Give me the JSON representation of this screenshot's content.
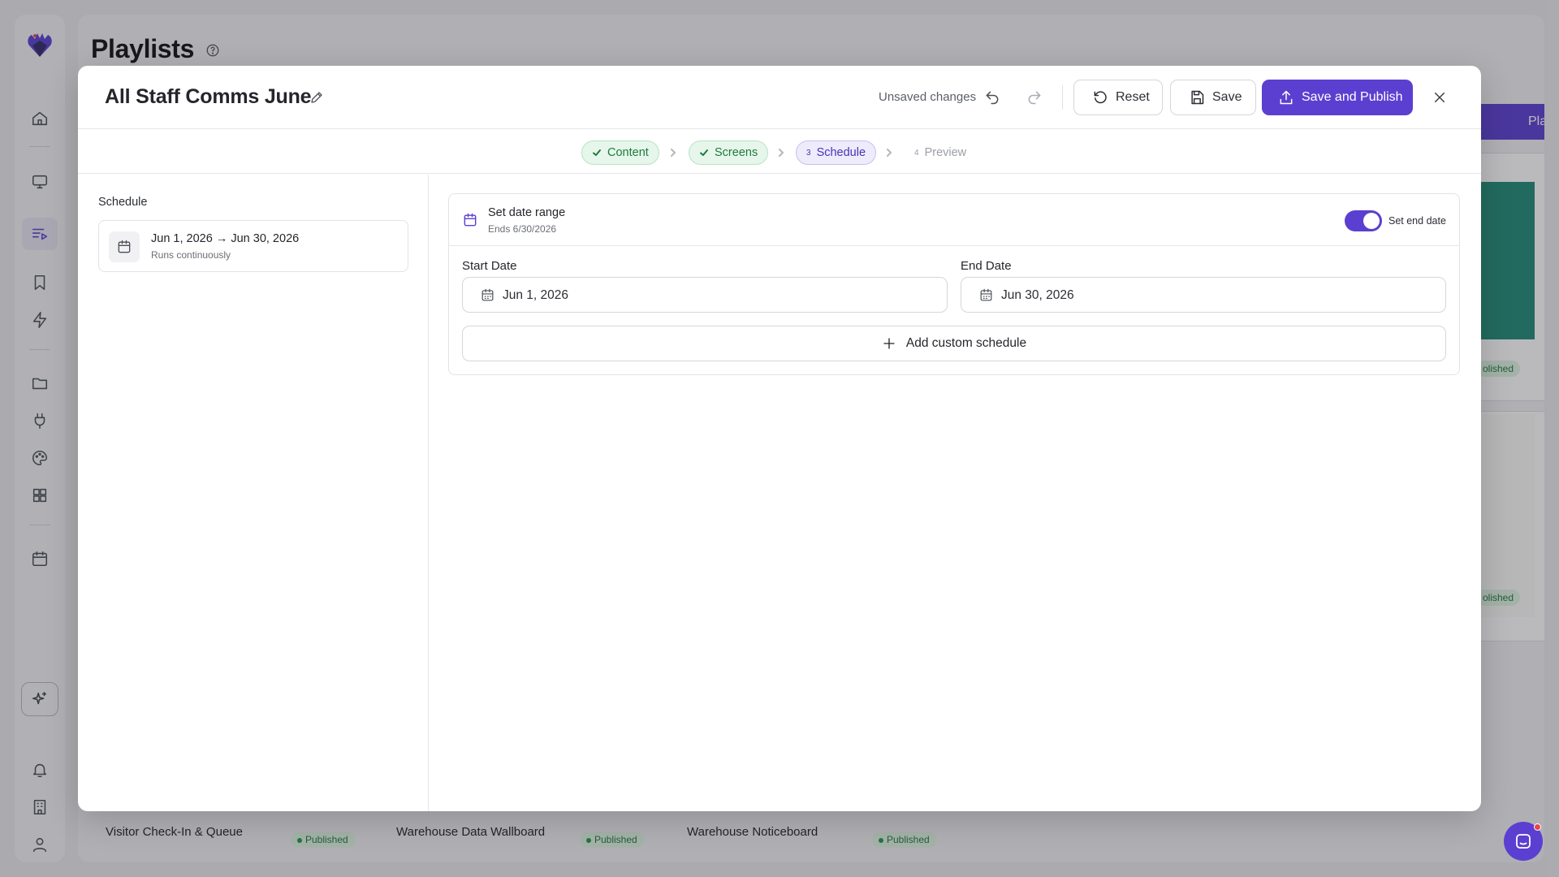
{
  "app": {
    "page_title": "Playlists",
    "new_button_label": "Playlist",
    "bg_status": "Published",
    "bg_status_partial": "olished",
    "bg_cards": [
      {
        "title": "Visitor Check-In & Queue",
        "status": "Published"
      },
      {
        "title": "Warehouse Data Wallboard",
        "status": "Published"
      },
      {
        "title": "Warehouse Noticeboard",
        "status": "Published"
      }
    ]
  },
  "modal": {
    "title": "All Staff Comms June",
    "unsaved_text": "Unsaved changes",
    "reset_label": "Reset",
    "save_label": "Save",
    "publish_label": "Save and Publish"
  },
  "steps": [
    {
      "label": "Content",
      "state": "done"
    },
    {
      "label": "Screens",
      "state": "done"
    },
    {
      "number": "3",
      "label": "Schedule",
      "state": "active"
    },
    {
      "number": "4",
      "label": "Preview",
      "state": "todo"
    }
  ],
  "left_panel": {
    "label": "Schedule",
    "item": {
      "title": "Jun 1, 2026 → Jun 30, 2026",
      "subtitle": "Runs continuously"
    }
  },
  "date_range": {
    "title": "Set date range",
    "subtitle": "Ends 6/30/2026",
    "toggle_label": "Set end date",
    "toggle_on": true,
    "start_label": "Start Date",
    "start_value": "Jun 1, 2026",
    "end_label": "End Date",
    "end_value": "Jun 30, 2026",
    "add_custom_label": "Add custom schedule"
  },
  "colors": {
    "accent": "#5b3fd1",
    "success_bg": "#e6f6ea",
    "success_text": "#1f7a3f"
  },
  "icons": [
    "logo-icon",
    "home-icon",
    "monitor-icon",
    "playlist-icon",
    "bookmark-icon",
    "lightning-icon",
    "folder-icon",
    "plug-icon",
    "palette-icon",
    "grid-icon",
    "calendar-icon",
    "sparkles-icon",
    "bell-icon",
    "building-icon",
    "user-icon",
    "help-icon",
    "pencil-icon",
    "undo-icon",
    "redo-icon",
    "reset-icon",
    "save-icon",
    "upload-icon",
    "close-icon",
    "check-icon",
    "chevron-right-icon",
    "plus-icon",
    "chat-icon"
  ]
}
